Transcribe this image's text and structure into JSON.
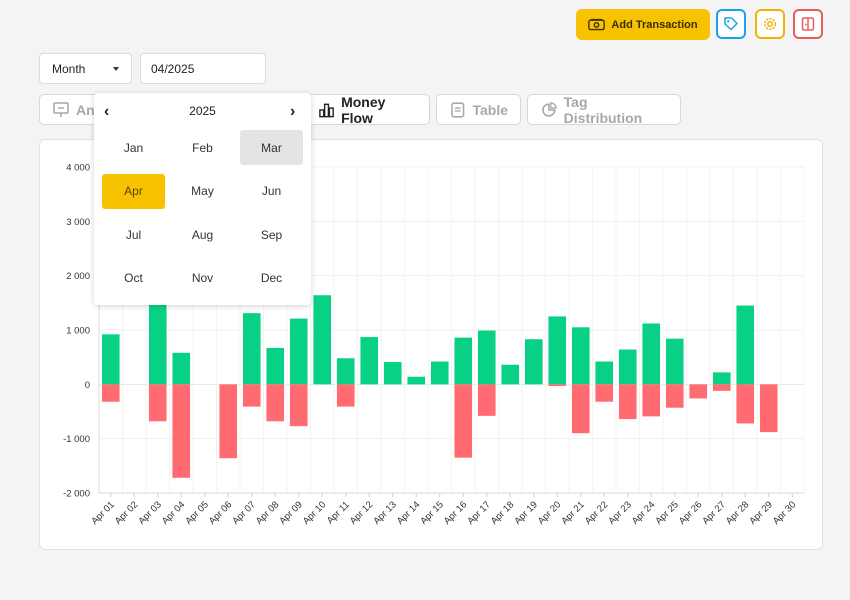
{
  "toolbar": {
    "add_label": "Add Transaction",
    "icons": [
      "tag-icon",
      "gear-icon",
      "logout-icon"
    ],
    "colors": {
      "accent": "#f7c200",
      "tag": "#1aa3e8",
      "gear": "#f0b400",
      "logout": "#e95b5b"
    }
  },
  "filters": {
    "period": "Month",
    "date": "04/2025"
  },
  "tabs": [
    {
      "label": "Analytics",
      "icon": "presentation-icon"
    },
    {
      "label": "Money Flow",
      "icon": "bar-chart-icon"
    },
    {
      "label": "Table",
      "icon": "document-icon"
    },
    {
      "label": "Tag Distribution",
      "icon": "pie-chart-icon"
    }
  ],
  "month_picker": {
    "year": "2025",
    "months": [
      "Jan",
      "Feb",
      "Mar",
      "Apr",
      "May",
      "Jun",
      "Jul",
      "Aug",
      "Sep",
      "Oct",
      "Nov",
      "Dec"
    ],
    "selected": "Apr",
    "hovered": "Mar"
  },
  "chart_data": {
    "type": "bar",
    "categories": [
      "Apr 01",
      "Apr 02",
      "Apr 03",
      "Apr 04",
      "Apr 05",
      "Apr 06",
      "Apr 07",
      "Apr 08",
      "Apr 09",
      "Apr 10",
      "Apr 11",
      "Apr 12",
      "Apr 13",
      "Apr 14",
      "Apr 15",
      "Apr 16",
      "Apr 17",
      "Apr 18",
      "Apr 19",
      "Apr 20",
      "Apr 21",
      "Apr 22",
      "Apr 23",
      "Apr 24",
      "Apr 25",
      "Apr 26",
      "Apr 27",
      "Apr 28",
      "Apr 29",
      "Apr 30"
    ],
    "series": [
      {
        "color": "#08d185",
        "values": [
          920,
          0,
          1460,
          580,
          0,
          0,
          1310,
          670,
          1210,
          1640,
          480,
          870,
          410,
          140,
          420,
          860,
          990,
          360,
          830,
          1250,
          1050,
          420,
          640,
          1120,
          840,
          0,
          220,
          1450,
          0,
          0
        ]
      },
      {
        "color": "#ff6b70",
        "values": [
          -320,
          0,
          -680,
          -1720,
          0,
          -1360,
          -410,
          -680,
          -770,
          0,
          -410,
          0,
          0,
          0,
          0,
          -1350,
          -580,
          0,
          0,
          -30,
          -900,
          -320,
          -640,
          -590,
          -430,
          -260,
          -120,
          -720,
          -880,
          0
        ]
      }
    ],
    "yticks": [
      4000,
      3000,
      2000,
      1000,
      0,
      -1000,
      -2000
    ],
    "ytick_labels": [
      "4 000",
      "3 000",
      "2 000",
      "1 000",
      "0",
      "-1 000",
      "-2 000"
    ],
    "ylim": [
      -2000,
      4000
    ],
    "grid": true,
    "stacked": true
  }
}
